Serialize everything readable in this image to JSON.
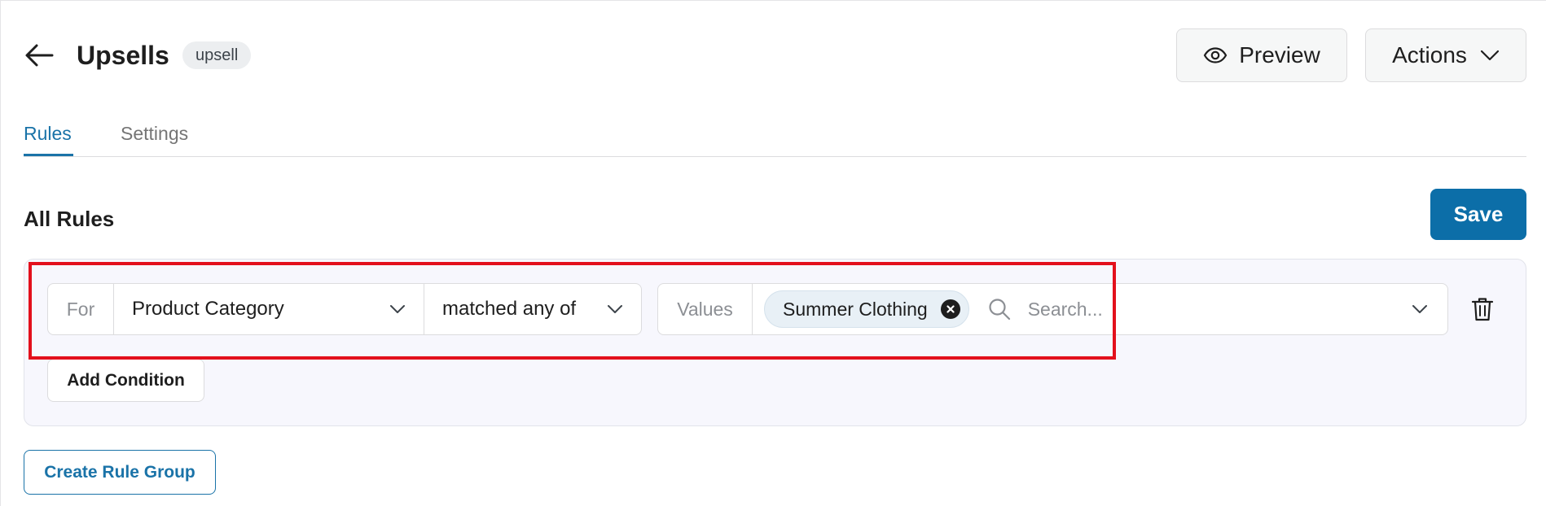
{
  "header": {
    "title": "Upsells",
    "badge": "upsell",
    "preview_label": "Preview",
    "actions_label": "Actions"
  },
  "tabs": [
    {
      "label": "Rules",
      "active": true
    },
    {
      "label": "Settings",
      "active": false
    }
  ],
  "section": {
    "title": "All Rules",
    "save_label": "Save"
  },
  "rule_group": {
    "condition": {
      "for_label": "For",
      "field": "Product Category",
      "operator": "matched any of",
      "values_label": "Values",
      "selected_values": [
        "Summer Clothing"
      ],
      "search_placeholder": "Search..."
    },
    "add_condition_label": "Add Condition"
  },
  "create_group_label": "Create Rule Group",
  "colors": {
    "accent": "#1a73a8",
    "save_bg": "#0c6ea8",
    "highlight": "#e3101c"
  },
  "icons": {
    "back": "arrow-left-icon",
    "preview": "eye-icon",
    "actions": "chevron-down-icon",
    "chip_remove": "close-circle-icon",
    "search": "search-icon",
    "delete": "trash-icon"
  }
}
